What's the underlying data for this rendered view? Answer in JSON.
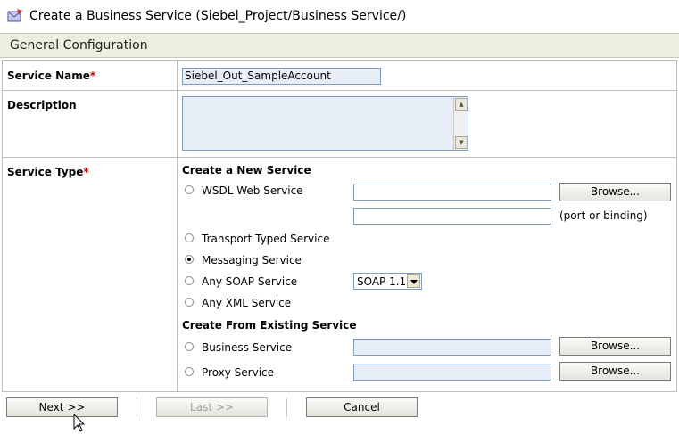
{
  "header": {
    "title": "Create a Business Service (Siebel_Project/Business Service/)",
    "section": "General Configuration"
  },
  "form": {
    "service_name": {
      "label": "Service Name",
      "required_mark": "*",
      "value": "Siebel_Out_SampleAccount"
    },
    "description": {
      "label": "Description",
      "value": ""
    },
    "service_type": {
      "label": "Service Type",
      "required_mark": "*",
      "create_new_heading": "Create a New Service",
      "options": {
        "wsdl": "WSDL Web Service",
        "transport": "Transport Typed Service",
        "messaging": "Messaging Service",
        "soap": "Any SOAP Service",
        "xml": "Any XML Service"
      },
      "selected": "Messaging Service",
      "port_binding_hint": "(port or binding)",
      "soap_version": "SOAP 1.1",
      "create_existing_heading": "Create From Existing Service",
      "existing_options": {
        "business": "Business Service",
        "proxy": "Proxy Service"
      },
      "browse_label": "Browse..."
    }
  },
  "nav": {
    "next": "Next >>",
    "last": "Last >>",
    "cancel": "Cancel"
  },
  "colors": {
    "section_bg": "#eeeedf",
    "input_bg": "#e8eef7",
    "required": "#cc0000"
  }
}
